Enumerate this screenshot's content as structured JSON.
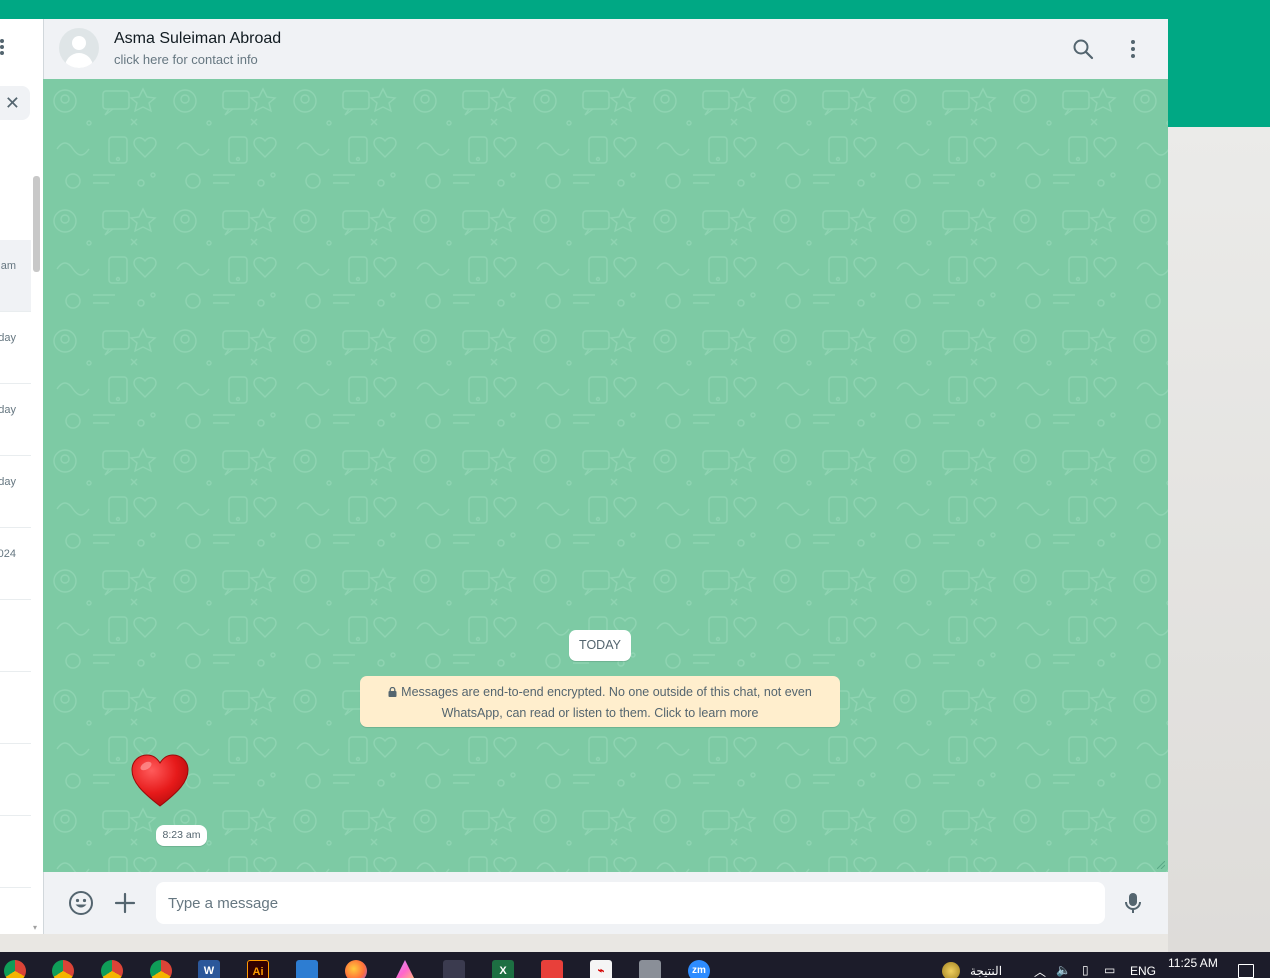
{
  "chat": {
    "contact_name": "Asma Suleiman Abroad",
    "contact_sub": "click here for contact info",
    "date_divider": "TODAY",
    "encryption_notice_line1": "Messages are end-to-end encrypted. No one outside of this chat, not even",
    "encryption_notice_line2": "WhatsApp, can read or listen to them. Click to learn more",
    "message": {
      "emoji": "heart",
      "time": "8:23 am"
    }
  },
  "composer": {
    "placeholder": "Type a message"
  },
  "chat_list_fragment": {
    "times": [
      "am",
      "day",
      "day",
      "day",
      "024"
    ]
  },
  "taskbar": {
    "apps": [
      "chrome",
      "chrome",
      "chrome",
      "chrome",
      "word",
      "illustrator",
      "paint",
      "firefox",
      "affinity",
      "pen-tool",
      "excel",
      "anydesk",
      "acrobat",
      "scanner",
      "zoom"
    ],
    "weather_label": "النتيجة",
    "language": "ENG",
    "clock_time": "11:25 AM"
  },
  "colors": {
    "brand_green": "#00a884",
    "chat_background": "#7dcaa4",
    "notice_background": "#ffeecd"
  }
}
